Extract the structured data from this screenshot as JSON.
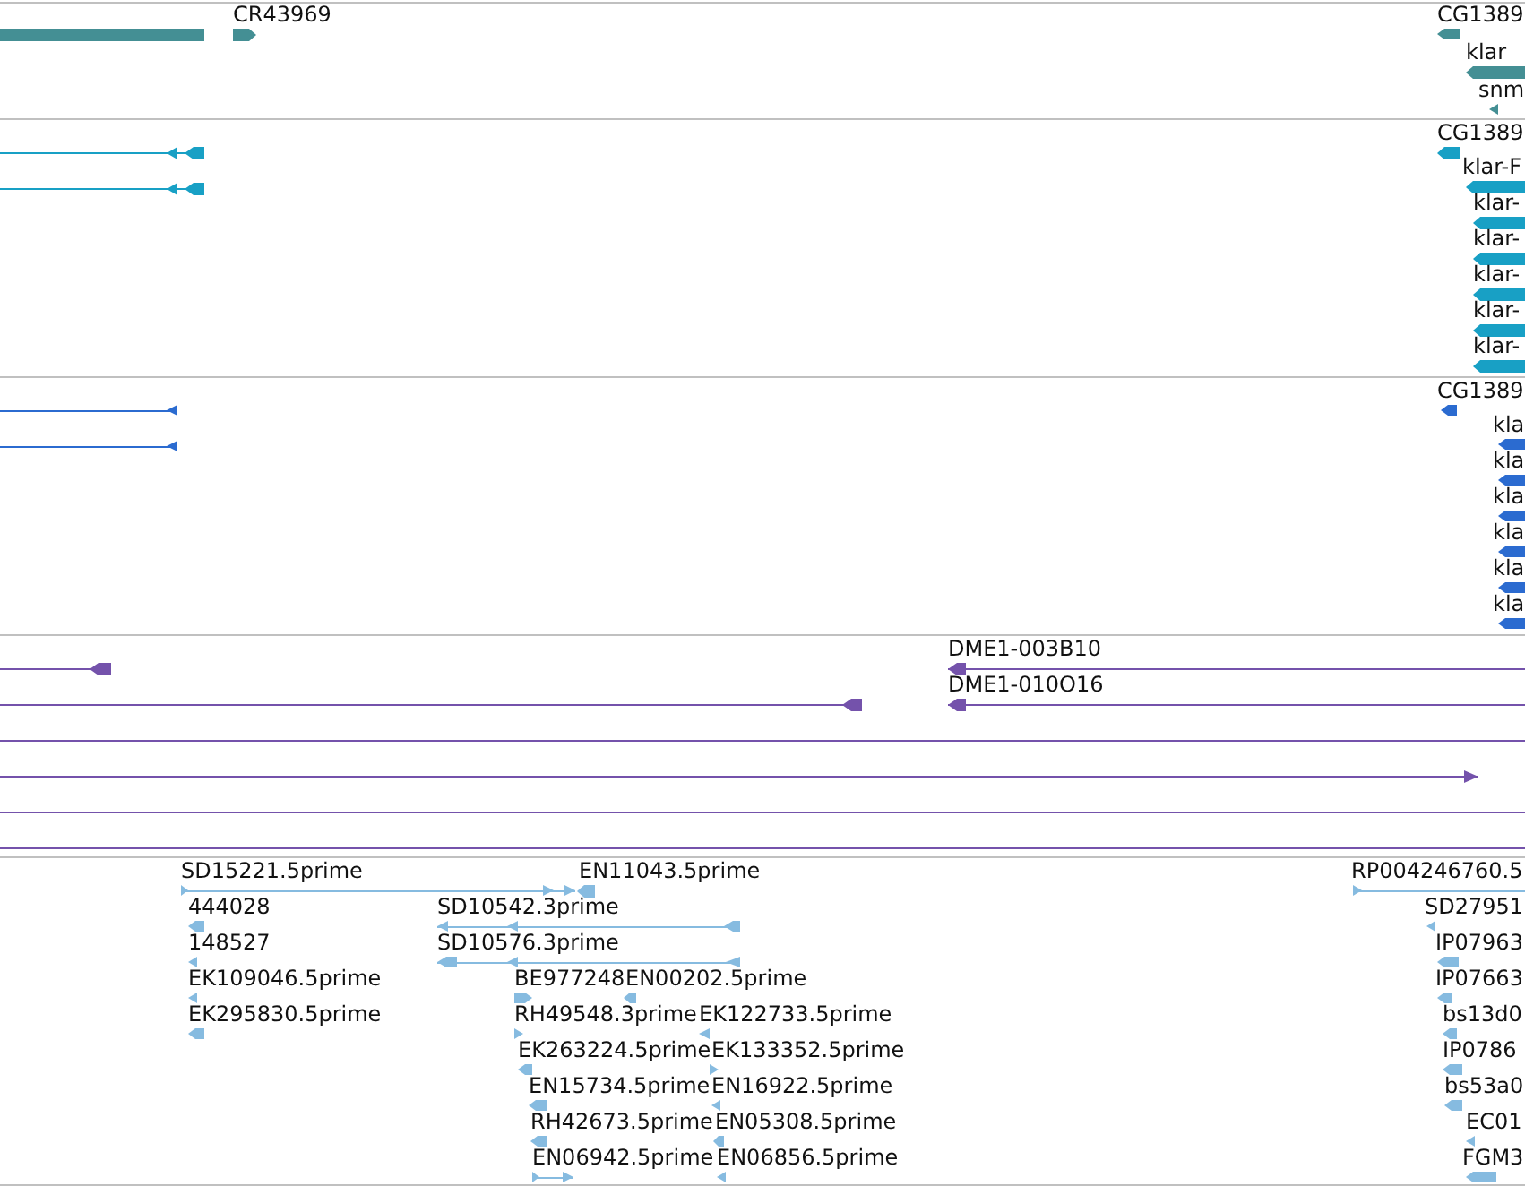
{
  "tracks": [
    {
      "features": [
        {
          "kind": "bar"
        },
        {
          "label": "CR43969",
          "kind": "bar",
          "reverse": false
        },
        {
          "label": "CG1389",
          "kind": "bar",
          "reverse": true
        },
        {
          "label": "klar",
          "kind": "bar",
          "reverse": true
        },
        {
          "label": "snm",
          "kind": "tick",
          "reverse": true
        }
      ]
    },
    {
      "features": [
        {
          "label": "CG1389",
          "kind": "bar",
          "reverse": true
        },
        {
          "kind": "line",
          "reverse": true
        },
        {
          "label": "klar-F",
          "kind": "bar",
          "reverse": true
        },
        {
          "kind": "line",
          "reverse": true
        },
        {
          "label": "klar-",
          "kind": "bar",
          "reverse": true
        },
        {
          "label": "klar-",
          "kind": "bar",
          "reverse": true
        },
        {
          "label": "klar-",
          "kind": "bar",
          "reverse": true
        },
        {
          "label": "klar-",
          "kind": "bar",
          "reverse": true
        },
        {
          "label": "klar-",
          "kind": "bar",
          "reverse": true
        }
      ]
    },
    {
      "features": [
        {
          "label": "CG1389",
          "kind": "bar",
          "reverse": true
        },
        {
          "kind": "line",
          "reverse": true
        },
        {
          "label": "kla",
          "kind": "bar",
          "reverse": true
        },
        {
          "kind": "line",
          "reverse": true
        },
        {
          "label": "kla",
          "kind": "bar",
          "reverse": true
        },
        {
          "label": "kla",
          "kind": "bar",
          "reverse": true
        },
        {
          "label": "kla",
          "kind": "bar",
          "reverse": true
        },
        {
          "label": "kla",
          "kind": "bar",
          "reverse": true
        },
        {
          "label": "kla",
          "kind": "bar",
          "reverse": true
        }
      ]
    },
    {
      "features": [
        {
          "label": "DME1-003B10",
          "kind": "line",
          "reverse": true
        },
        {
          "kind": "line",
          "reverse": true
        },
        {
          "label": "DME1-010O16",
          "kind": "line",
          "reverse": true
        },
        {
          "kind": "line",
          "reverse": true
        },
        {
          "kind": "line"
        },
        {
          "kind": "line",
          "reverse": false
        },
        {
          "kind": "line"
        },
        {
          "kind": "line"
        }
      ]
    },
    {
      "features": [
        {
          "label": "SD15221.5prime",
          "kind": "line",
          "reverse": false
        },
        {
          "label": "EN11043.5prime",
          "kind": "bar",
          "reverse": true
        },
        {
          "label": "RP004246760.5",
          "kind": "line",
          "reverse": false
        },
        {
          "label": "444028",
          "kind": "bar",
          "reverse": true
        },
        {
          "label": "SD10542.3prime",
          "kind": "line",
          "reverse": true
        },
        {
          "label": "SD27951",
          "kind": "tick",
          "reverse": true
        },
        {
          "label": "148527",
          "kind": "tick",
          "reverse": true
        },
        {
          "label": "SD10576.3prime",
          "kind": "line",
          "reverse": true
        },
        {
          "label": "IP07963",
          "kind": "bar",
          "reverse": true
        },
        {
          "label": "EK109046.5prime",
          "kind": "tick",
          "reverse": true
        },
        {
          "label": "BE977248",
          "kind": "bar",
          "reverse": false
        },
        {
          "label": "EN00202.5prime",
          "kind": "bar",
          "reverse": true
        },
        {
          "label": "IP07663",
          "kind": "bar",
          "reverse": true
        },
        {
          "label": "EK295830.5prime",
          "kind": "bar",
          "reverse": true
        },
        {
          "label": "RH49548.3prime",
          "kind": "tick",
          "reverse": false
        },
        {
          "label": "EK122733.5prime",
          "kind": "tick",
          "reverse": true
        },
        {
          "label": "bs13d0",
          "kind": "bar",
          "reverse": true
        },
        {
          "label": "EK263224.5prime",
          "kind": "bar",
          "reverse": true
        },
        {
          "label": "EK133352.5prime",
          "kind": "tick",
          "reverse": false
        },
        {
          "label": "IP0786",
          "kind": "bar",
          "reverse": true
        },
        {
          "label": "EN15734.5prime",
          "kind": "bar",
          "reverse": true
        },
        {
          "label": "EN16922.5prime",
          "kind": "tick",
          "reverse": true
        },
        {
          "label": "bs53a0",
          "kind": "bar",
          "reverse": true
        },
        {
          "label": "RH42673.5prime",
          "kind": "bar",
          "reverse": true
        },
        {
          "label": "EN05308.5prime",
          "kind": "bar",
          "reverse": true
        },
        {
          "label": "EC01",
          "kind": "tick",
          "reverse": true
        },
        {
          "label": "EN06942.5prime",
          "kind": "line",
          "reverse": false
        },
        {
          "label": "EN06856.5prime",
          "kind": "tick",
          "reverse": true
        },
        {
          "label": "FGM3",
          "kind": "bar",
          "reverse": true
        }
      ]
    }
  ]
}
